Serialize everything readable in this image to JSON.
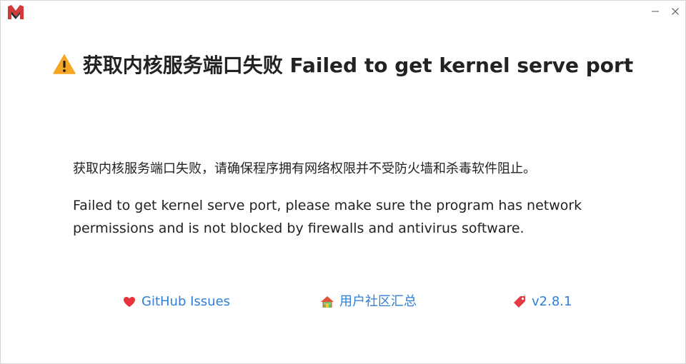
{
  "window": {
    "controls": {
      "minimize_icon": "minimize-icon",
      "close_icon": "close-icon"
    }
  },
  "headline": {
    "icon": "warning-icon",
    "text": "获取内核服务端口失败 Failed to get kernel serve port"
  },
  "message": {
    "cn": "获取内核服务端口失败，请确保程序拥有网络权限并不受防火墙和杀毒软件阻止。",
    "en": "Failed to get kernel serve port, please make sure the program has network permissions and is not blocked by firewalls and antivirus software."
  },
  "links": [
    {
      "icon": "heart-icon",
      "label": "GitHub Issues"
    },
    {
      "icon": "house-icon",
      "label": "用户社区汇总"
    },
    {
      "icon": "tag-icon",
      "label": "v2.8.1"
    }
  ],
  "colors": {
    "link": "#2f7fd6",
    "warning": "#f5a623",
    "logo": "#d23a3a"
  }
}
